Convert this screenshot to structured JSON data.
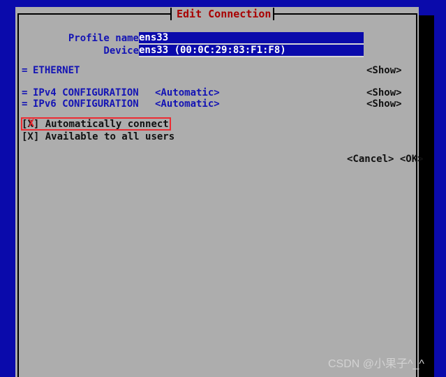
{
  "terminal": {
    "background_color": "#0a0aab"
  },
  "dialog": {
    "title": "Edit Connection",
    "title_color": "#a80000",
    "surface_color": "#adadad",
    "accent_blue": "#1414b4",
    "fields": [
      {
        "label": "Profile name",
        "value": "ens33",
        "placeholder": "ens33"
      },
      {
        "label": "Device",
        "value": "ens33 (00:0C:29:83:F1:F8)",
        "placeholder": "ens33 (00:0C:29:83:F1:F8)"
      }
    ],
    "sections": [
      {
        "marker": "=",
        "label": "ETHERNET",
        "mode": "",
        "action": "<Show>"
      },
      {
        "marker": "=",
        "label": "IPv4 CONFIGURATION",
        "mode": "<Automatic>",
        "action": "<Show>"
      },
      {
        "marker": "=",
        "label": "IPv6 CONFIGURATION",
        "mode": "<Automatic>",
        "action": "<Show>"
      }
    ],
    "checkboxes": [
      {
        "box": "[X]",
        "label": "Automatically connect",
        "checked": "X",
        "highlighted": "true"
      },
      {
        "box": "[X]",
        "label": "Available to all users",
        "checked": "X",
        "highlighted": "false"
      }
    ],
    "buttons": {
      "cancel_label": "<Cancel>",
      "ok_label": "<OK>"
    }
  },
  "annotation": {
    "color": "#ec2b32",
    "x_mark": "X"
  },
  "watermark": {
    "text": "CSDN @小果子^_^"
  }
}
